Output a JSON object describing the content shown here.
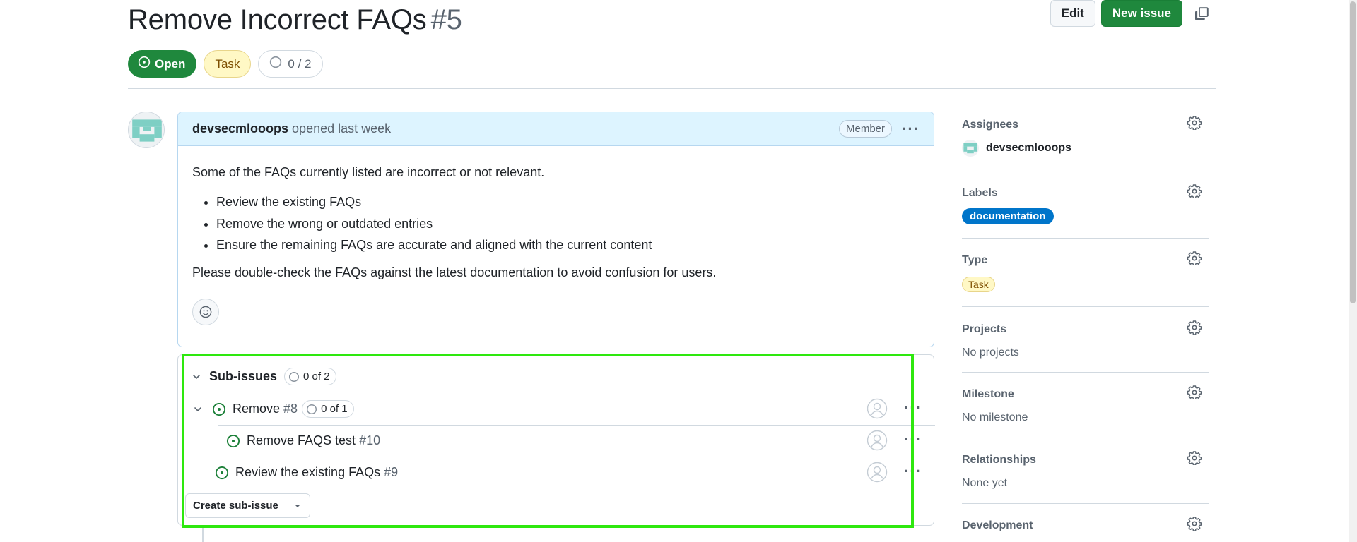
{
  "issue": {
    "title": "Remove Incorrect FAQs",
    "number": "#5",
    "state": "Open",
    "type": "Task",
    "progress": "0 / 2"
  },
  "header_actions": {
    "edit_label": "Edit",
    "new_issue_label": "New issue"
  },
  "comment": {
    "author": "devsecmlooops",
    "opened": "opened last week",
    "role_badge": "Member",
    "intro": "Some of the FAQs currently listed are incorrect or not relevant.",
    "bullets": [
      "Review the existing FAQs",
      "Remove the wrong or outdated entries",
      "Ensure the remaining FAQs are accurate and aligned with the current content"
    ],
    "closing": "Please double-check the FAQs against the latest documentation to avoid confusion for users."
  },
  "sub_issues": {
    "title": "Sub-issues",
    "count": "0 of 2",
    "items": [
      {
        "title": "Remove",
        "number": "#8",
        "count": "0 of 1"
      },
      {
        "title": "Remove FAQS test",
        "number": "#10"
      },
      {
        "title": "Review the existing FAQs",
        "number": "#9"
      }
    ],
    "create_label": "Create sub-issue"
  },
  "sidebar": {
    "assignees": {
      "title": "Assignees",
      "value": "devsecmlooops"
    },
    "labels": {
      "title": "Labels",
      "value": "documentation"
    },
    "type": {
      "title": "Type",
      "value": "Task"
    },
    "projects": {
      "title": "Projects",
      "value": "No projects"
    },
    "milestone": {
      "title": "Milestone",
      "value": "No milestone"
    },
    "relationships": {
      "title": "Relationships",
      "value": "None yet"
    },
    "development": {
      "title": "Development"
    }
  },
  "colors": {
    "open_green": "#1f883d",
    "label_documentation": "#0075ca",
    "highlight": "#2ee80e"
  }
}
